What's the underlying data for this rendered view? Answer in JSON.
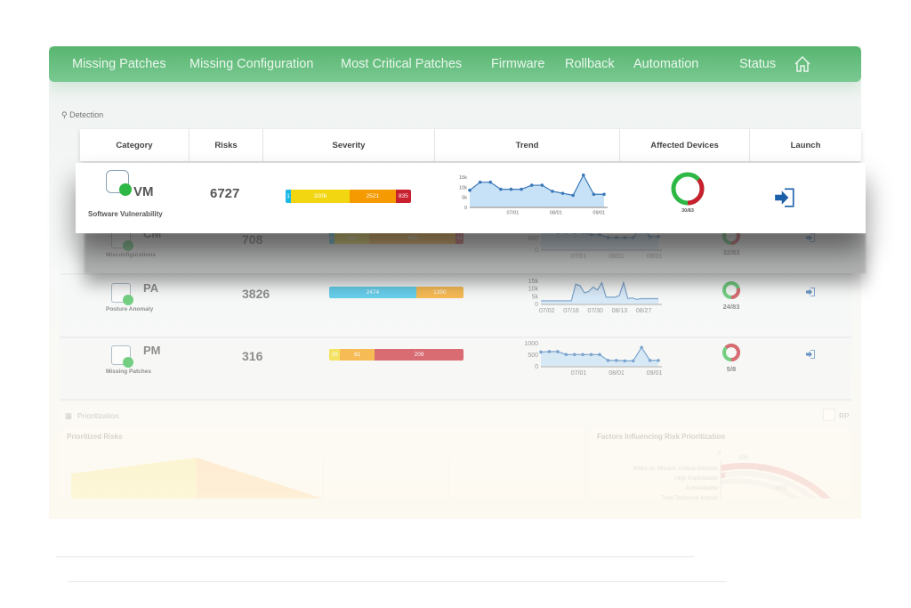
{
  "nav": {
    "items": [
      "Missing Patches",
      "Missing Configuration",
      "Most Critical Patches",
      "Firmware",
      "Rollback",
      "Automation",
      "Status"
    ],
    "home_icon": "home-icon"
  },
  "detection": {
    "title": "Detection",
    "icon": "search-icon"
  },
  "columns": [
    "Category",
    "Risks",
    "Severity",
    "Trend",
    "Affected Devices",
    "Launch"
  ],
  "colors": {
    "accent": "#5cb874",
    "critical": "#c8202e",
    "high": "#f59a00",
    "medium": "#f2d612",
    "low": "#1cb9e6",
    "donut_red": "#c8202e",
    "donut_green": "#2db845",
    "trend_line": "#3a78b8",
    "trend_fill": "#c7e1f7",
    "launch": "#1b5fa8"
  },
  "rows": [
    {
      "code": "VM",
      "name": "Software Vulnerability",
      "risks": "6727",
      "icon": "shield-bug-icon",
      "severity": [
        {
          "v": 1,
          "c": "#1cb9e6"
        },
        {
          "v": 3206,
          "c": "#f2d612"
        },
        {
          "v": 2521,
          "c": "#f59a00"
        },
        {
          "v": 835,
          "c": "#c8202e"
        }
      ],
      "trend": {
        "ylabels": [
          "15k",
          "10k",
          "5k",
          "0"
        ],
        "ymax": 15000,
        "xlabels": [
          "07/01",
          "08/01",
          "09/01"
        ],
        "values": [
          8500,
          12500,
          12500,
          9000,
          9000,
          9000,
          11000,
          11000,
          8000,
          7000,
          6000,
          16000,
          6500,
          6500
        ]
      },
      "affected": 30,
      "total": 83,
      "affected_label": "30/83"
    },
    {
      "code": "CM",
      "name": "Misconfigurations",
      "risks": "708",
      "icon": "checklist-gear-icon",
      "severity": [
        {
          "v": 30,
          "c": "#1cb9e6"
        },
        {
          "v": 181,
          "c": "#f2d612"
        },
        {
          "v": 455,
          "c": "#f59a00"
        },
        {
          "v": 42,
          "c": "#c8202e"
        }
      ],
      "trend": {
        "ylabels": [
          "1000",
          "500",
          "0"
        ],
        "ymax": 1200,
        "xlabels": [
          "07/01",
          "08/01",
          "09/01"
        ],
        "values": [
          1000,
          1000,
          900,
          900,
          900,
          900,
          800,
          800,
          650,
          650,
          650,
          650,
          1300,
          700,
          700
        ]
      },
      "affected": 32,
      "total": 83,
      "affected_label": "32/83"
    },
    {
      "code": "PA",
      "name": "Posture Anomaly",
      "risks": "3826",
      "icon": "scatter-anomaly-icon",
      "severity": [
        {
          "v": 2474,
          "c": "#1cb9e6"
        },
        {
          "v": 1350,
          "c": "#f59a00"
        }
      ],
      "trend": {
        "ylabels": [
          "15k",
          "10k",
          "5k",
          "0"
        ],
        "ymax": 16000,
        "xlabels": [
          "07/02",
          "07/16",
          "07/30",
          "08/13",
          "08/27"
        ],
        "values": [
          2500,
          2500,
          2500,
          2500,
          2500,
          2500,
          2500,
          2500,
          14000,
          13000,
          8000,
          9000,
          12000,
          10000,
          15000,
          5000,
          5000,
          5000,
          6000,
          15000,
          4000,
          4500,
          3500,
          4000,
          4000,
          4000,
          4000,
          4000
        ]
      },
      "affected": 24,
      "total": 83,
      "affected_label": "24/83"
    },
    {
      "code": "PM",
      "name": "Missing Patches",
      "risks": "316",
      "icon": "chip-grid-icon",
      "severity": [
        {
          "v": 26,
          "c": "#f2d612"
        },
        {
          "v": 81,
          "c": "#f59a00"
        },
        {
          "v": 209,
          "c": "#c8202e"
        }
      ],
      "trend": {
        "ylabels": [
          "1000",
          "500",
          "0"
        ],
        "ymax": 1100,
        "xlabels": [
          "07/01",
          "08/01",
          "09/01"
        ],
        "values": [
          700,
          720,
          720,
          580,
          580,
          580,
          580,
          580,
          300,
          300,
          280,
          280,
          920,
          300,
          300
        ]
      },
      "affected": 5,
      "total": 8,
      "affected_label": "5/8"
    }
  ],
  "prioritization": {
    "title": "Prioritization",
    "rp_label": "RP",
    "prioritized_risks": {
      "title": "Prioritized Risks"
    },
    "factors": {
      "title": "Factors Influencing Risk Prioritization",
      "ticks": [
        "0",
        "500",
        "1000",
        "1500"
      ],
      "labels": [
        "Risks on Mission Critical Devices",
        "High Exploitation",
        "Automatable",
        "Total Technical Impact"
      ]
    }
  }
}
